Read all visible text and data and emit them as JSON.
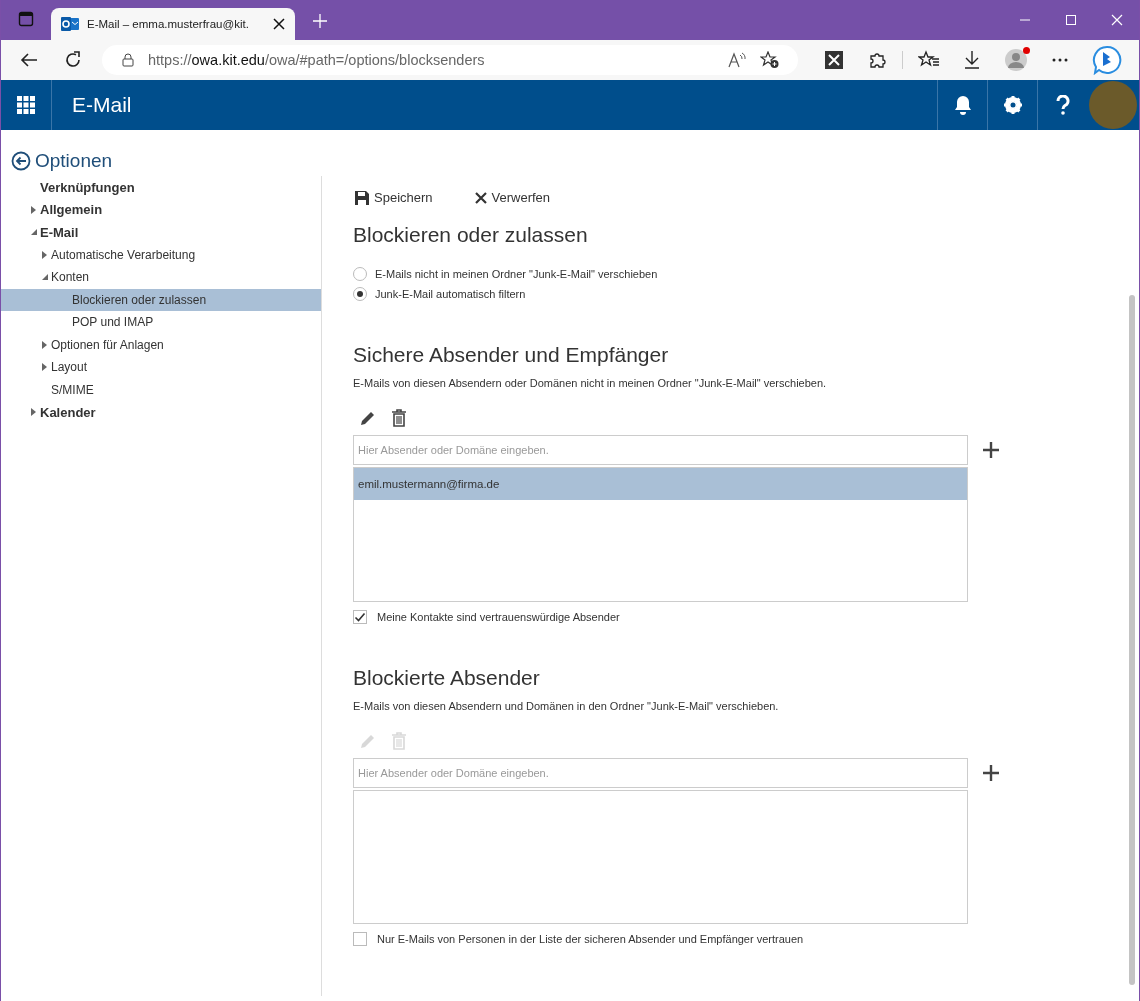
{
  "browser": {
    "tab_title": "E-Mail – emma.musterfrau@kit.",
    "url": {
      "scheme": "https://",
      "host": "owa.kit.edu",
      "path": "/owa/#path=/options/blocksenders"
    },
    "profile_notification": true
  },
  "app_header": {
    "title": "E-Mail"
  },
  "sidebar": {
    "back_label": "Optionen",
    "items": [
      {
        "label": "Verknüpfungen",
        "selected": false
      },
      {
        "label": "Allgemein",
        "selected": false,
        "expanded": false
      },
      {
        "label": "E-Mail",
        "selected": false,
        "expanded": true,
        "children": [
          {
            "label": "Automatische Verarbeitung",
            "selected": false,
            "expanded": false
          },
          {
            "label": "Konten",
            "selected": false,
            "expanded": true,
            "children": [
              {
                "label": "Blockieren oder zulassen",
                "selected": true
              },
              {
                "label": "POP und IMAP",
                "selected": false
              }
            ]
          },
          {
            "label": "Optionen für Anlagen",
            "selected": false,
            "expanded": false
          },
          {
            "label": "Layout",
            "selected": false,
            "expanded": false
          },
          {
            "label": "S/MIME",
            "selected": false
          }
        ]
      },
      {
        "label": "Kalender",
        "selected": false,
        "expanded": false
      }
    ]
  },
  "toolbar": [
    {
      "kind": "save",
      "label": "Speichern"
    },
    {
      "kind": "discard",
      "label": "Verwerfen"
    }
  ],
  "title": "Blockieren oder zulassen",
  "filter_options": [
    {
      "label": "E-Mails nicht in meinen Ordner \"Junk-E-Mail\" verschieben",
      "selected": false
    },
    {
      "label": "Junk-E-Mail automatisch filtern",
      "selected": true
    }
  ],
  "sections": [
    {
      "heading": "Sichere Absender und Empfänger",
      "description": "E-Mails von diesen Absendern oder Domänen nicht in meinen Ordner \"Junk-E-Mail\" verschieben.",
      "tools_disabled": false,
      "placeholder": "Hier Absender oder Domäne eingeben.",
      "entries": [
        {
          "label": "emil.mustermann@firma.de",
          "selected": true
        }
      ],
      "checkbox": {
        "label": "Meine Kontakte sind vertrauenswürdige Absender",
        "checked": true
      }
    },
    {
      "heading": "Blockierte Absender",
      "description": "E-Mails von diesen Absendern und Domänen in den Ordner \"Junk-E-Mail\" verschieben.",
      "tools_disabled": true,
      "placeholder": "Hier Absender oder Domäne eingeben.",
      "checkbox": {
        "label": "Nur E-Mails von Personen in der Liste der sicheren Absender und Empfänger vertrauen",
        "checked": false
      }
    }
  ]
}
